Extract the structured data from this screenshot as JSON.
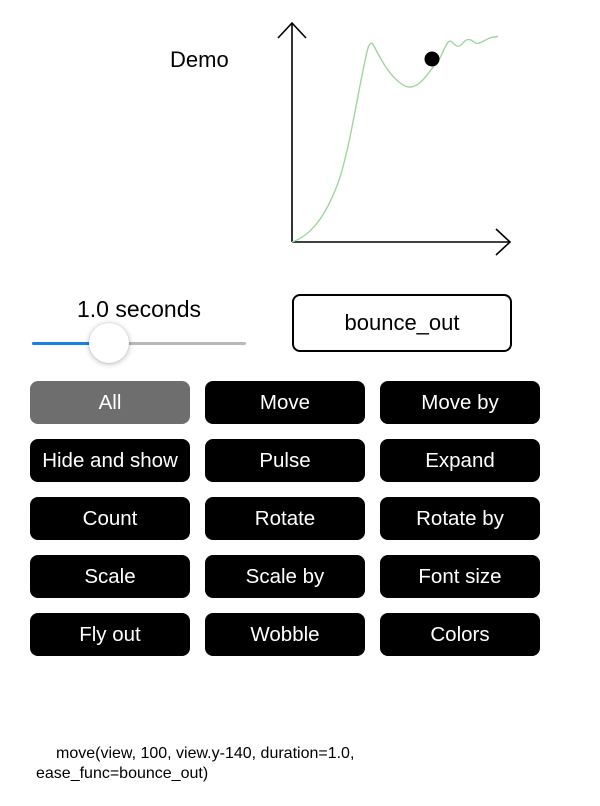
{
  "demo": {
    "label": "Demo",
    "curve_color": "#9fd49f",
    "axis_color": "#000000",
    "marker_color": "#000000"
  },
  "duration": {
    "label": "1.0 seconds",
    "slider_value_fraction": 0.36,
    "fill_color": "#1a7fe8",
    "track_color": "#b9b9b9"
  },
  "easing": {
    "value": "bounce_out"
  },
  "buttons": [
    {
      "label": "All",
      "selected": true
    },
    {
      "label": "Move",
      "selected": false
    },
    {
      "label": "Move by",
      "selected": false
    },
    {
      "label": "Hide and show",
      "selected": false
    },
    {
      "label": "Pulse",
      "selected": false
    },
    {
      "label": "Expand",
      "selected": false
    },
    {
      "label": "Count",
      "selected": false
    },
    {
      "label": "Rotate",
      "selected": false
    },
    {
      "label": "Rotate by",
      "selected": false
    },
    {
      "label": "Scale",
      "selected": false
    },
    {
      "label": "Scale by",
      "selected": false
    },
    {
      "label": "Font size",
      "selected": false
    },
    {
      "label": "Fly out",
      "selected": false
    },
    {
      "label": "Wobble",
      "selected": false
    },
    {
      "label": "Colors",
      "selected": false
    }
  ],
  "colors": {
    "button_bg": "#000000",
    "button_selected_bg": "#6e6e6e",
    "button_text": "#ffffff"
  },
  "code": {
    "text": "move(view, 100, view.y-140, duration=1.0, ease_func=bounce_out)"
  }
}
